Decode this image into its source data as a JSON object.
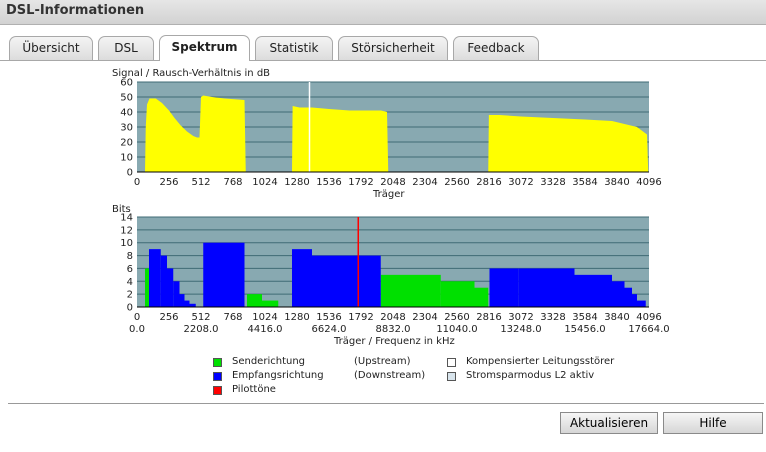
{
  "window": {
    "title": "DSL-Informationen"
  },
  "tabs": [
    {
      "label": "Übersicht",
      "active": false
    },
    {
      "label": "DSL",
      "active": false
    },
    {
      "label": "Spektrum",
      "active": true
    },
    {
      "label": "Statistik",
      "active": false
    },
    {
      "label": "Störsicherheit",
      "active": false
    },
    {
      "label": "Feedback",
      "active": false
    }
  ],
  "colors": {
    "plot_bg": "#88a9b1",
    "snr_fill": "#ffff00",
    "upstream": "#00e000",
    "downstream": "#0000ff",
    "pilot": "#ff0000",
    "grid": "#3f6b75"
  },
  "chart_data": [
    {
      "type": "area",
      "title": "Signal / Rausch-Verhältnis in dB",
      "xlabel": "Träger",
      "ylabel": "",
      "xlim": [
        0,
        4096
      ],
      "ylim": [
        0,
        60
      ],
      "xticks": [
        0,
        256,
        512,
        768,
        1024,
        1280,
        1536,
        1792,
        2048,
        2304,
        2560,
        2816,
        3072,
        3328,
        3584,
        3840,
        4096
      ],
      "yticks": [
        0,
        10,
        20,
        30,
        40,
        50,
        60
      ],
      "grid": true,
      "series": [
        {
          "color": "#ffff00",
          "points": [
            [
              64,
              0
            ],
            [
              70,
              30
            ],
            [
              80,
              45
            ],
            [
              100,
              49
            ],
            [
              150,
              49
            ],
            [
              200,
              46
            ],
            [
              256,
              41
            ],
            [
              300,
              36
            ],
            [
              350,
              31
            ],
            [
              400,
              27
            ],
            [
              450,
              24
            ],
            [
              480,
              23
            ],
            [
              500,
              23
            ],
            [
              512,
              50
            ],
            [
              530,
              51
            ],
            [
              600,
              50
            ],
            [
              700,
              49
            ],
            [
              860,
              48
            ],
            [
              870,
              0
            ],
            [
              1240,
              0
            ],
            [
              1245,
              44
            ],
            [
              1300,
              43
            ],
            [
              1400,
              43
            ],
            [
              1536,
              42
            ],
            [
              1700,
              41
            ],
            [
              1950,
              41
            ],
            [
              2000,
              40
            ],
            [
              2010,
              0
            ],
            [
              2810,
              0
            ],
            [
              2815,
              38
            ],
            [
              2900,
              38
            ],
            [
              3072,
              37
            ],
            [
              3328,
              36
            ],
            [
              3584,
              35
            ],
            [
              3800,
              34
            ],
            [
              3900,
              32
            ],
            [
              4000,
              30
            ],
            [
              4080,
              25
            ],
            [
              4090,
              0
            ]
          ]
        }
      ],
      "marker_x": 1380
    },
    {
      "type": "bar",
      "title": "Bits",
      "xlabel": "Träger / Frequenz in kHz",
      "ylabel": "",
      "xlim": [
        0,
        4096
      ],
      "ylim": [
        0,
        14
      ],
      "xticks": [
        0,
        256,
        512,
        768,
        1024,
        1280,
        1536,
        1792,
        2048,
        2304,
        2560,
        2816,
        3072,
        3328,
        3584,
        3840,
        4096
      ],
      "xticks_khz": [
        "0.0",
        "2208.0",
        "4416.0",
        "6624.0",
        "8832.0",
        "11040.0",
        "13248.0",
        "15456.0",
        "17664.0"
      ],
      "yticks": [
        0,
        2,
        4,
        6,
        8,
        10,
        12,
        14
      ],
      "grid": true,
      "series": [
        {
          "name": "Senderichtung",
          "color": "#00e000",
          "segments": [
            [
              64,
              96,
              6
            ],
            [
              880,
              1000,
              2
            ],
            [
              1000,
              1130,
              1
            ],
            [
              1950,
              2430,
              5
            ],
            [
              2430,
              2700,
              4
            ],
            [
              2700,
              2810,
              3
            ]
          ]
        },
        {
          "name": "Empfangsrichtung",
          "color": "#0000ff",
          "segments": [
            [
              96,
              190,
              9
            ],
            [
              190,
              240,
              8
            ],
            [
              240,
              290,
              6
            ],
            [
              290,
              340,
              4
            ],
            [
              340,
              380,
              2
            ],
            [
              380,
              420,
              1
            ],
            [
              420,
              470,
              0.5
            ],
            [
              530,
              860,
              10
            ],
            [
              1240,
              1400,
              9
            ],
            [
              1400,
              1536,
              8
            ],
            [
              1536,
              1820,
              8
            ],
            [
              1820,
              1950,
              8
            ],
            [
              2820,
              3050,
              6
            ],
            [
              3050,
              3500,
              6
            ],
            [
              3500,
              3800,
              5
            ],
            [
              3800,
              3900,
              4
            ],
            [
              3900,
              3960,
              3
            ],
            [
              3960,
              4000,
              2
            ],
            [
              4000,
              4070,
              1
            ]
          ]
        }
      ],
      "pilot_x": 1770
    }
  ],
  "legend": {
    "upstream_label": "Senderichtung",
    "upstream_note": "(Upstream)",
    "downstream_label": "Empfangsrichtung",
    "downstream_note": "(Downstream)",
    "pilot_label": "Pilottöne",
    "compensated_label": "Kompensierter Leitungsstörer",
    "l2_label": "Stromsparmodus L2 aktiv"
  },
  "buttons": {
    "refresh": "Aktualisieren",
    "help": "Hilfe"
  }
}
